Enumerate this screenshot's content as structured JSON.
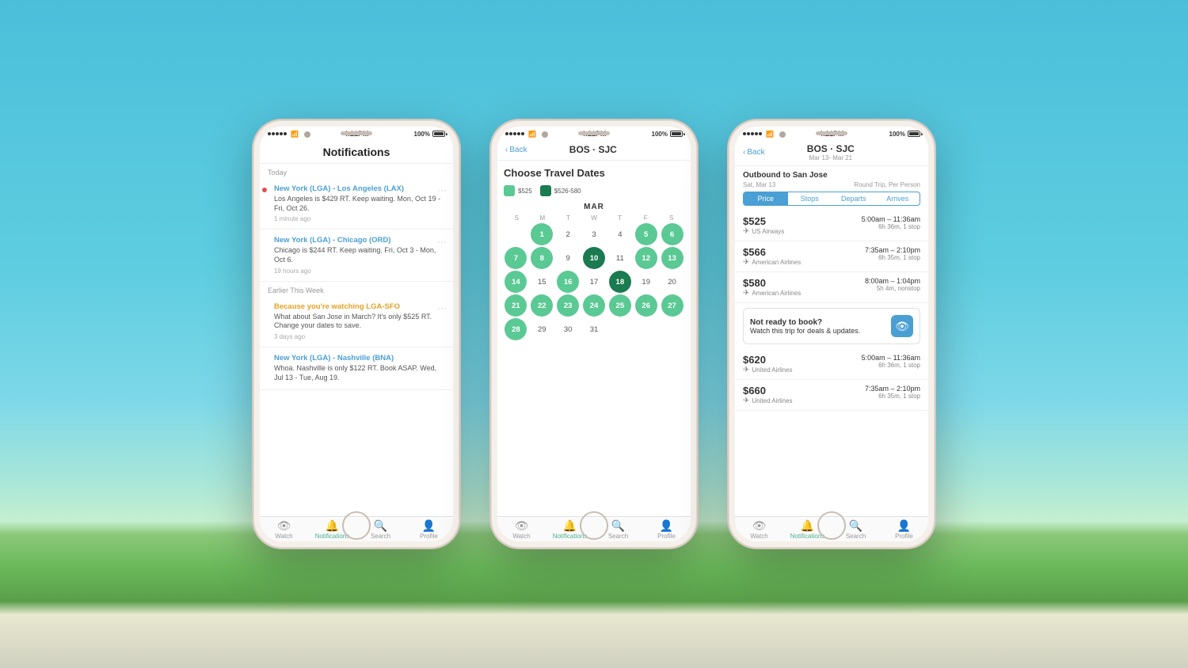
{
  "background": {
    "sky_color_top": "#4BBFDA",
    "sky_color_bottom": "#7DD8E8"
  },
  "phones": [
    {
      "id": "phone1",
      "status_bar": {
        "signal": "•••••",
        "wifi": "wifi",
        "time": "4:21PM",
        "battery": "100%"
      },
      "screen": "notifications",
      "header": "Notifications",
      "sections": [
        {
          "label": "Today",
          "items": [
            {
              "title": "New York (LGA) - Los Angeles (LAX)",
              "body": "Los Angeles is $429 RT. Keep waiting. Mon, Oct 19 - Fri, Oct 26.",
              "time": "1 minute ago",
              "has_dot": true,
              "title_color": "blue"
            },
            {
              "title": "New York (LGA) - Chicago (ORD)",
              "body": "Chicago is $244 RT. Keep waiting. Fri, Oct 3 - Mon, Oct 6.",
              "time": "19 hours ago",
              "has_dot": false,
              "title_color": "blue"
            }
          ]
        },
        {
          "label": "Earlier This Week",
          "items": [
            {
              "title": "Because you're watching LGA-SFO",
              "body": "What about San Jose in March? It's only $525 RT. Change your dates to save.",
              "time": "3 days ago",
              "has_dot": false,
              "title_color": "orange"
            },
            {
              "title": "New York (LGA) - Nashville (BNA)",
              "body": "Whoa. Nashville is only $122 RT. Book ASAP. Wed, Jul 13 - Tue, Aug 19.",
              "time": "",
              "has_dot": false,
              "title_color": "blue"
            }
          ]
        }
      ],
      "tabs": [
        {
          "label": "Watch",
          "icon": "👁",
          "active": false
        },
        {
          "label": "Notifications",
          "icon": "🔔",
          "active": true
        },
        {
          "label": "Search",
          "icon": "🔍",
          "active": false
        },
        {
          "label": "Profile",
          "icon": "👤",
          "active": false
        }
      ]
    },
    {
      "id": "phone2",
      "status_bar": {
        "signal": "•••••",
        "wifi": "wifi",
        "time": "4:21PM",
        "battery": "100%"
      },
      "screen": "calendar",
      "back_label": "Back",
      "header_title": "BOS · SJC",
      "cal_title": "Choose Travel Dates",
      "legend": [
        {
          "label": "$525",
          "type": "light"
        },
        {
          "label": "$526-580",
          "type": "dark"
        }
      ],
      "month": "MAR",
      "weekdays": [
        "S",
        "M",
        "T",
        "W",
        "T",
        "F",
        "S"
      ],
      "days": [
        {
          "num": "",
          "style": "empty"
        },
        {
          "num": "1",
          "style": "green"
        },
        {
          "num": "2",
          "style": "empty"
        },
        {
          "num": "3",
          "style": "empty"
        },
        {
          "num": "4",
          "style": "empty"
        },
        {
          "num": "5",
          "style": "green"
        },
        {
          "num": "6",
          "style": "green"
        },
        {
          "num": "7",
          "style": "green"
        },
        {
          "num": "8",
          "style": "green"
        },
        {
          "num": "9",
          "style": "empty"
        },
        {
          "num": "10",
          "style": "dark-green"
        },
        {
          "num": "11",
          "style": "empty"
        },
        {
          "num": "12",
          "style": "green"
        },
        {
          "num": "13",
          "style": "green"
        },
        {
          "num": "14",
          "style": "green"
        },
        {
          "num": "15",
          "style": "empty"
        },
        {
          "num": "16",
          "style": "green"
        },
        {
          "num": "17",
          "style": "empty"
        },
        {
          "num": "18",
          "style": "dark-green"
        },
        {
          "num": "19",
          "style": "empty"
        },
        {
          "num": "20",
          "style": "empty"
        },
        {
          "num": "21",
          "style": "green"
        },
        {
          "num": "22",
          "style": "green"
        },
        {
          "num": "23",
          "style": "green"
        },
        {
          "num": "24",
          "style": "green"
        },
        {
          "num": "25",
          "style": "green"
        },
        {
          "num": "26",
          "style": "green"
        },
        {
          "num": "27",
          "style": "green"
        },
        {
          "num": "28",
          "style": "green"
        },
        {
          "num": "29",
          "style": "empty"
        },
        {
          "num": "30",
          "style": "empty"
        },
        {
          "num": "31",
          "style": "empty"
        },
        {
          "num": "",
          "style": "empty"
        },
        {
          "num": "",
          "style": "empty"
        },
        {
          "num": "",
          "style": "empty"
        }
      ],
      "tabs": [
        {
          "label": "Watch",
          "icon": "👁",
          "active": false
        },
        {
          "label": "Notifications",
          "icon": "🔔",
          "active": true
        },
        {
          "label": "Search",
          "icon": "🔍",
          "active": false
        },
        {
          "label": "Profile",
          "icon": "👤",
          "active": false
        }
      ]
    },
    {
      "id": "phone3",
      "status_bar": {
        "signal": "•••••",
        "wifi": "wifi",
        "time": "4:21PM",
        "battery": "100%"
      },
      "screen": "flights",
      "back_label": "Back",
      "header_title": "BOS · SJC",
      "header_sub": "Mar 13- Mar 21",
      "section_title": "Outbound to San Jose",
      "section_sub_left": "Sat, Mar 13",
      "section_sub_right": "Round Trip, Per Person",
      "sort_tabs": [
        "Price",
        "Stops",
        "Departs",
        "Arrives"
      ],
      "active_sort": "Price",
      "flights": [
        {
          "price": "$525",
          "airline": "US Airways",
          "time": "5:00am – 11:36am",
          "duration": "6h 36m, 1 stop"
        },
        {
          "price": "$566",
          "airline": "American Airlines",
          "time": "7:35am – 2:10pm",
          "duration": "6h 35m, 1 stop"
        },
        {
          "price": "$580",
          "airline": "American Airlines",
          "time": "8:00am – 1:04pm",
          "duration": "5h 4m, nonstop"
        }
      ],
      "watch_card": {
        "title": "Not ready to book?",
        "body": "Watch this trip for deals & updates."
      },
      "more_flights": [
        {
          "price": "$620",
          "airline": "United Airlines",
          "time": "5:00am – 11:36am",
          "duration": "6h 36m, 1 stop"
        },
        {
          "price": "$660",
          "airline": "United Airlines",
          "time": "7:35am – 2:10pm",
          "duration": "6h 35m, 1 stop"
        }
      ],
      "tabs": [
        {
          "label": "Watch",
          "icon": "👁",
          "active": false
        },
        {
          "label": "Notifications",
          "icon": "🔔",
          "active": true
        },
        {
          "label": "Search",
          "icon": "🔍",
          "active": false
        },
        {
          "label": "Profile",
          "icon": "👤",
          "active": false
        }
      ]
    }
  ]
}
